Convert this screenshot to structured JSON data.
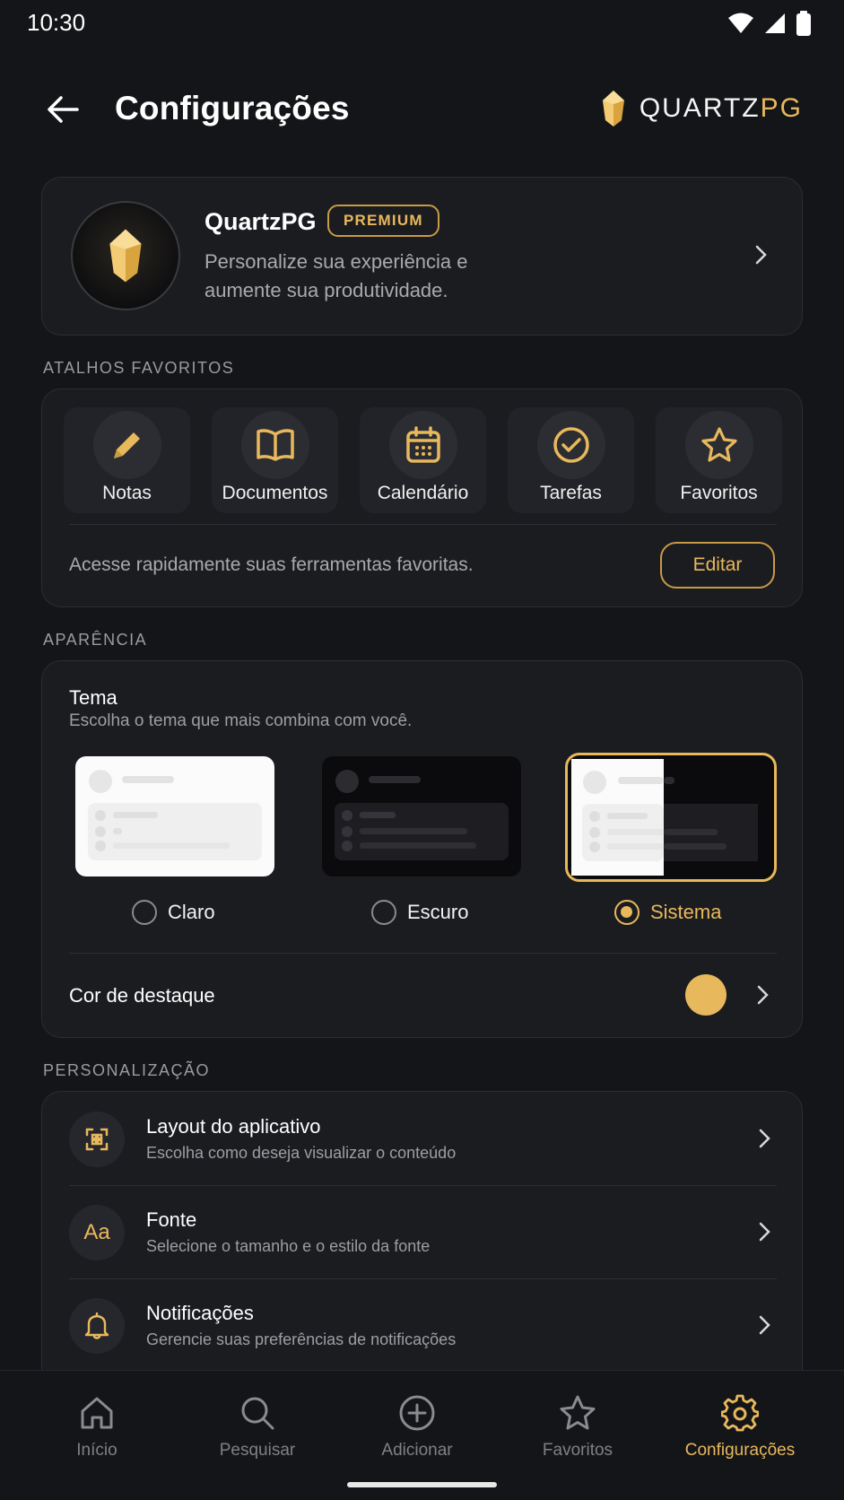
{
  "status": {
    "time": "10:30"
  },
  "header": {
    "title": "Configurações",
    "brand_main": "QUARTZ",
    "brand_accent": "PG"
  },
  "profile": {
    "name": "QuartzPG",
    "badge": "PREMIUM",
    "description": "Personalize sua experiência e aumente sua produtividade."
  },
  "shortcuts": {
    "section_label": "ATALHOS FAVORITOS",
    "items": [
      {
        "label": "Notas",
        "icon": "pencil-icon"
      },
      {
        "label": "Documentos",
        "icon": "book-icon"
      },
      {
        "label": "Calendário",
        "icon": "calendar-icon"
      },
      {
        "label": "Tarefas",
        "icon": "check-circle-icon"
      },
      {
        "label": "Favoritos",
        "icon": "star-icon"
      }
    ],
    "hint": "Acesse rapidamente suas ferramentas favoritas.",
    "edit_label": "Editar"
  },
  "appearance": {
    "section_label": "APARÊNCIA",
    "theme_title": "Tema",
    "theme_subtitle": "Escolha o tema que mais combina com você.",
    "themes": [
      {
        "label": "Claro",
        "selected": false
      },
      {
        "label": "Escuro",
        "selected": false
      },
      {
        "label": "Sistema",
        "selected": true
      }
    ],
    "accent_label": "Cor de destaque",
    "accent_color": "#e8b85c"
  },
  "personalization": {
    "section_label": "PERSONALIZAÇÃO",
    "items": [
      {
        "title": "Layout do aplicativo",
        "subtitle": "Escolha como deseja visualizar o conteúdo",
        "icon": "layout-icon"
      },
      {
        "title": "Fonte",
        "subtitle": "Selecione o tamanho e o estilo da fonte",
        "icon": "font-icon",
        "glyph": "Aa"
      },
      {
        "title": "Notificações",
        "subtitle": "Gerencie suas preferências de notificações",
        "icon": "bell-icon"
      }
    ]
  },
  "nav": {
    "items": [
      {
        "label": "Início",
        "icon": "home-icon"
      },
      {
        "label": "Pesquisar",
        "icon": "search-icon"
      },
      {
        "label": "Adicionar",
        "icon": "add-circle-icon"
      },
      {
        "label": "Favoritos",
        "icon": "star-icon"
      },
      {
        "label": "Configurações",
        "icon": "gear-icon",
        "active": true
      }
    ]
  },
  "colors": {
    "accent": "#e8b85c",
    "background": "#141518",
    "card": "#1b1c20"
  }
}
